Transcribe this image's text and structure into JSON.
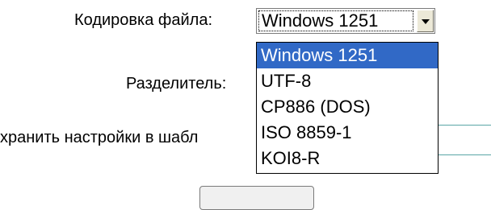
{
  "form": {
    "encoding_label": "Кодировка файла:",
    "separator_label": "Разделитель:",
    "save_settings_label": "хранить настройки в шабл"
  },
  "encoding_select": {
    "selected_value": "Windows 1251",
    "options": [
      "Windows 1251",
      "UTF-8",
      "CP886 (DOS)",
      "ISO 8859-1",
      "KOI8-R"
    ],
    "highlight_color": "#3169c6"
  },
  "icons": {
    "dropdown_arrow": "chevron-down-icon"
  },
  "colors": {
    "field_border": "#5aa6a6"
  }
}
